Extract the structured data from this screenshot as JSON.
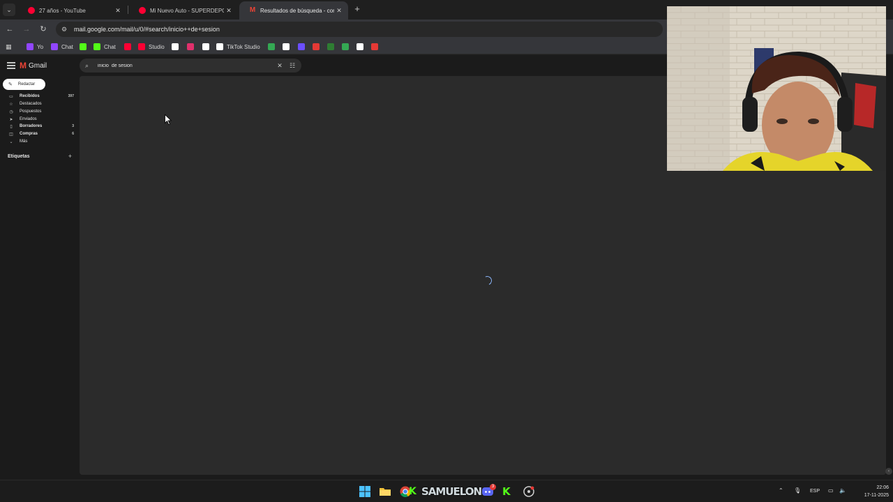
{
  "browser": {
    "tabs": [
      {
        "title": "27 años - YouTube",
        "favicon": "youtube-icon",
        "active": false
      },
      {
        "title": "Mi Nuevo Auto - SUPERDEPORTIVO",
        "favicon": "youtube-icon",
        "active": false
      },
      {
        "title": "Resultados de búsqueda - correo",
        "favicon": "gmail-icon",
        "active": true
      }
    ],
    "url": "mail.google.com/mail/u/0/#search/inicio++de+sesion",
    "bookmarks": [
      {
        "label": "Yo",
        "icon": "twitch-icon",
        "color": "#9146ff"
      },
      {
        "label": "Chat",
        "icon": "twitch-icon",
        "color": "#9146ff"
      },
      {
        "label": "",
        "icon": "kick-icon",
        "color": "#53fc18"
      },
      {
        "label": "Chat",
        "icon": "kick-icon",
        "color": "#53fc18"
      },
      {
        "label": "",
        "icon": "youtube-icon",
        "color": "#ff0033"
      },
      {
        "label": "Studio",
        "icon": "youtube-studio-icon",
        "color": "#ff0033"
      },
      {
        "label": "",
        "icon": "x-icon",
        "color": "#ffffff"
      },
      {
        "label": "",
        "icon": "instagram-icon",
        "color": "#e1306c"
      },
      {
        "label": "",
        "icon": "tiktok-icon",
        "color": "#ffffff"
      },
      {
        "label": "TikTok Studio",
        "icon": "tiktok-icon",
        "color": "#ffffff"
      },
      {
        "label": "",
        "icon": "google-drive-icon",
        "color": "#34a853"
      },
      {
        "label": "",
        "icon": "diamond-icon",
        "color": "#ffffff"
      },
      {
        "label": "",
        "icon": "chat-icon",
        "color": "#6b4eff"
      },
      {
        "label": "",
        "icon": "record-icon",
        "color": "#e53935"
      },
      {
        "label": "",
        "icon": "photo-icon",
        "color": "#2e7d32"
      },
      {
        "label": "",
        "icon": "sheets-icon",
        "color": "#34a853"
      },
      {
        "label": "",
        "icon": "unity-icon",
        "color": "#ffffff"
      },
      {
        "label": "",
        "icon": "download-icon",
        "color": "#e53935"
      }
    ]
  },
  "gmail": {
    "app_name": "Gmail",
    "search_query": "inicio  de sesion",
    "compose_label": "Redactar",
    "nav": [
      {
        "label": "Recibidos",
        "count": "397",
        "icon": "inbox-icon",
        "bold": true
      },
      {
        "label": "Destacados",
        "count": "",
        "icon": "star-icon",
        "bold": false
      },
      {
        "label": "Pospuestos",
        "count": "",
        "icon": "clock-icon",
        "bold": false
      },
      {
        "label": "Enviados",
        "count": "",
        "icon": "send-icon",
        "bold": false
      },
      {
        "label": "Borradores",
        "count": "3",
        "icon": "draft-icon",
        "bold": true
      },
      {
        "label": "Compras",
        "count": "6",
        "icon": "shopping-icon",
        "bold": true
      },
      {
        "label": "Más",
        "count": "",
        "icon": "chevron-down-icon",
        "bold": false
      }
    ],
    "labels_heading": "Etiquetas",
    "loading": true
  },
  "taskbar": {
    "stream_name": "SAMUELON",
    "discord_badge": "3",
    "language": "ESP",
    "time": "22:06",
    "date": "17-11-2025"
  },
  "colors": {
    "gmail_red": "#ea4335",
    "spinner_blue": "#8ab4f8",
    "kick_green": "#53fc18"
  }
}
